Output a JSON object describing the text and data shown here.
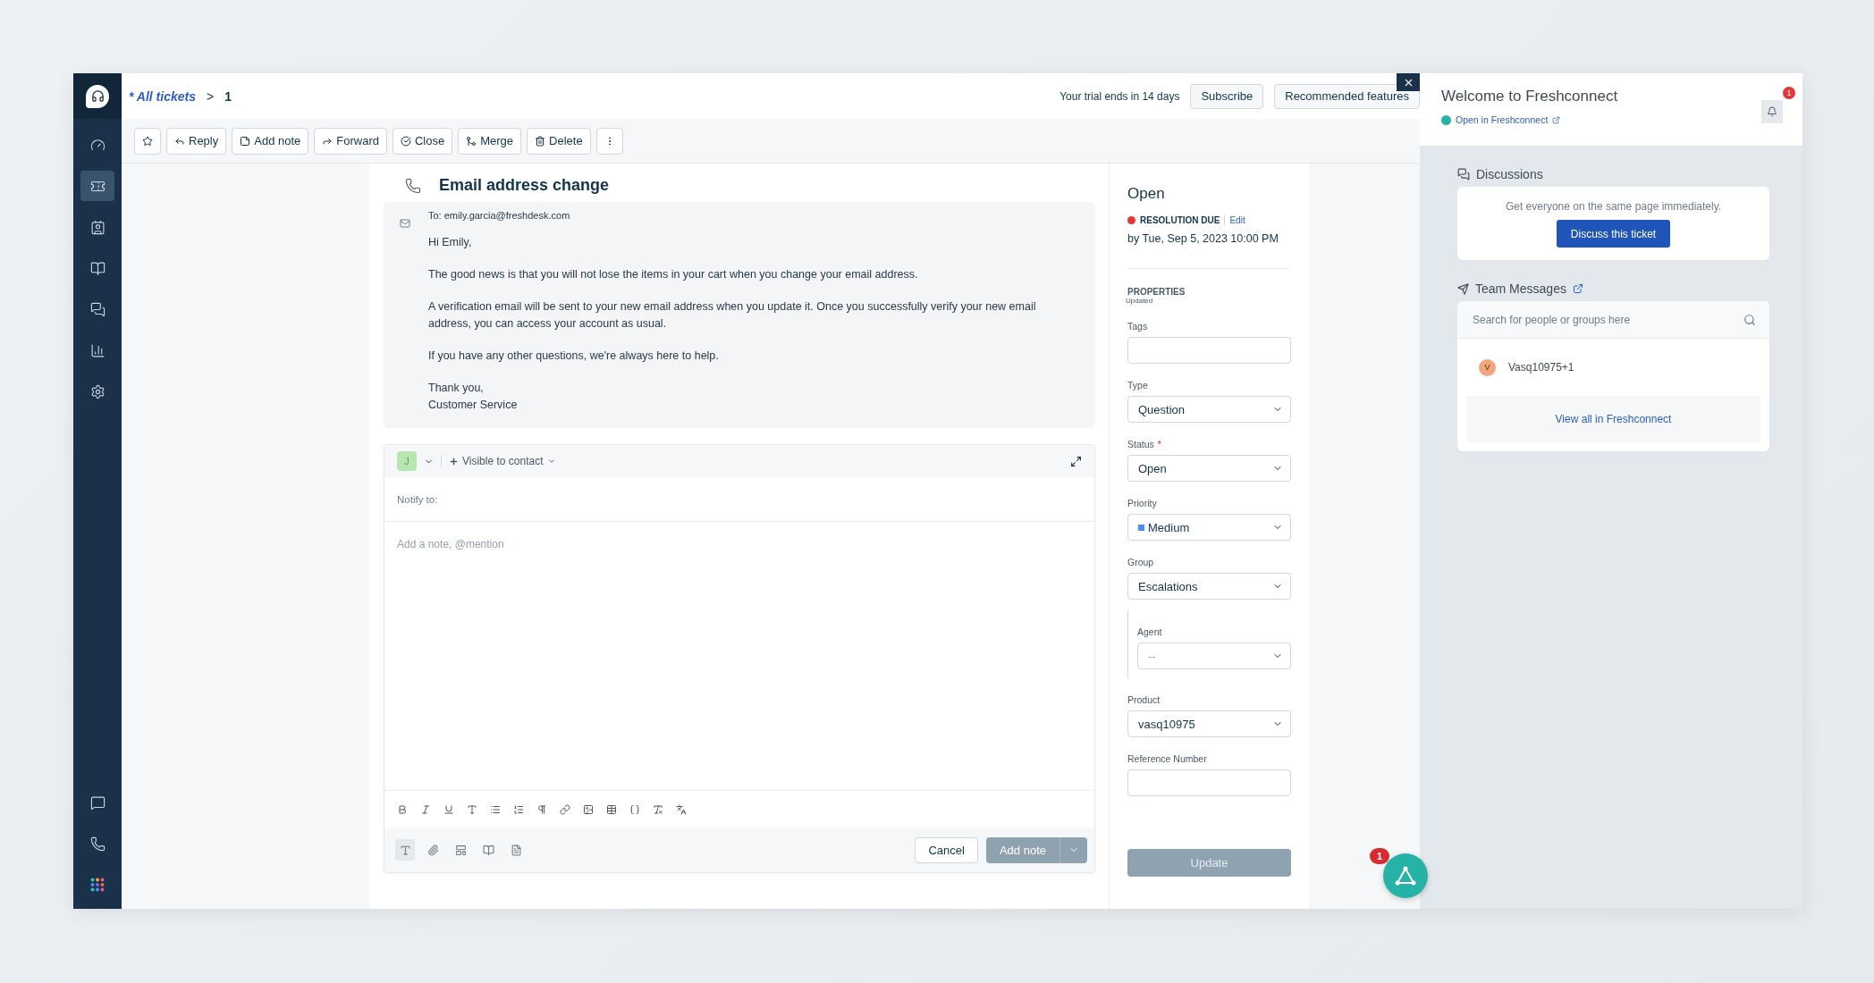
{
  "sidebar": {
    "items": [
      {
        "kind": "dashboard",
        "selected": false
      },
      {
        "kind": "tickets",
        "selected": true
      },
      {
        "kind": "contacts",
        "selected": false
      },
      {
        "kind": "solutions",
        "selected": false
      },
      {
        "kind": "forums",
        "selected": false
      },
      {
        "kind": "reports",
        "selected": false
      },
      {
        "kind": "admin",
        "selected": false
      }
    ],
    "bottom_items": [
      {
        "kind": "chat",
        "selected": false
      },
      {
        "kind": "phone",
        "selected": false
      },
      {
        "kind": "apps",
        "selected": false
      }
    ]
  },
  "topbar": {
    "breadcrumb": {
      "link": "* All tickets",
      "separator": ">",
      "current": "1"
    },
    "trial": "Your trial ends in 14 days",
    "buttons": [
      "Subscribe",
      "Recommended features"
    ]
  },
  "toolbar": [
    {
      "kind": "star"
    },
    {
      "kind": "reply",
      "label": "Reply"
    },
    {
      "kind": "note",
      "label": "Add note"
    },
    {
      "kind": "forward",
      "label": "Forward"
    },
    {
      "kind": "close",
      "label": "Close"
    },
    {
      "kind": "merge",
      "label": "Merge"
    },
    {
      "kind": "delete",
      "label": "Delete"
    },
    {
      "kind": "more"
    }
  ],
  "ticket": {
    "title": "Email address change",
    "to": "To: emily.garcia@freshdesk.com",
    "body": [
      "Hi Emily,",
      "The good news is that you will not lose the items in your cart when you change your email address.",
      "A verification email will be sent to your new email address when you update it. Once you successfully verify your new email address, you can access your account as usual.",
      "If you have any other questions, we're always here to help.",
      "Thank you,\nCustomer Service"
    ]
  },
  "editor": {
    "avatar": "J",
    "visibility": "Visible to contact",
    "notify": "Notify to:",
    "placeholder": "Add a note, @mention",
    "cancel": "Cancel",
    "submit": {
      "label": "Add note",
      "disabled": true
    }
  },
  "properties": {
    "status": "Open",
    "resolution": {
      "label": "RESOLUTION DUE",
      "edit": "Edit",
      "due": "by Tue, Sep 5, 2023 10:00 PM"
    },
    "heading": "PROPERTIES",
    "subheading": "Updated",
    "fields": [
      {
        "kind": "text",
        "label": "Tags"
      },
      {
        "kind": "select",
        "label": "Type",
        "value": "Question"
      },
      {
        "kind": "select",
        "label": "Status",
        "value": "Open",
        "required_mark": "*"
      },
      {
        "kind": "select",
        "label": "Priority",
        "value": "Medium",
        "color": "#4a8ff0"
      },
      {
        "kind": "select",
        "label": "Group",
        "value": "Escalations",
        "children": [
          {
            "kind": "select",
            "label": "Agent",
            "value": "--"
          }
        ]
      },
      {
        "kind": "select",
        "label": "Product",
        "value": "vasq10975"
      },
      {
        "kind": "text",
        "label": "Reference Number"
      }
    ],
    "update": {
      "label": "Update",
      "disabled": true
    }
  },
  "freshconnect": {
    "title": "Welcome to Freshconnect",
    "open_link": "Open in Freshconnect",
    "notifications": "1",
    "discussions": {
      "title": "Discussions",
      "text": "Get everyone on the same page immediately.",
      "button": "Discuss this ticket"
    },
    "team_messages": {
      "title": "Team Messages",
      "search_placeholder": "Search for people or groups here",
      "contacts": [
        {
          "initial": "V",
          "name": "Vasq10975+1"
        }
      ],
      "view_all": "View all in Freshconnect"
    }
  },
  "fab": {
    "badge": "1"
  }
}
